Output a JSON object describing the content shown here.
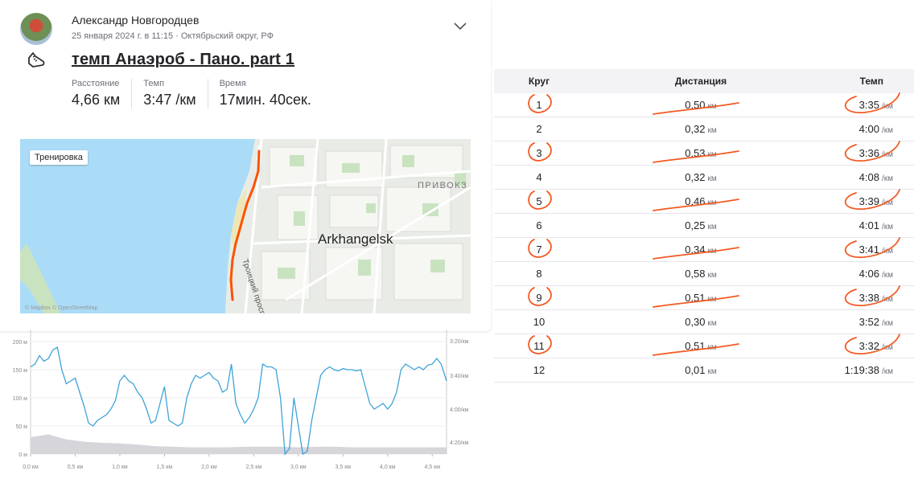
{
  "header": {
    "author": "Александр Новгородцев",
    "meta": "25 января 2024 г. в 11:15 · Октябрьский округ, РФ",
    "title": "темп Анаэроб - Пано. part 1",
    "icons": [
      "avatar",
      "chevron-down-icon",
      "shoe-icon"
    ]
  },
  "stats": [
    {
      "label": "Расстояние",
      "value": "4,66 км"
    },
    {
      "label": "Темп",
      "value": "3:47 /км"
    },
    {
      "label": "Время",
      "value": "17мин. 40сек."
    }
  ],
  "map": {
    "tag": "Тренировка",
    "city": "Arkhangelsk",
    "district": "ПРИВОКЗ",
    "street": "Троицкий просп",
    "credit": "© Mapbox © OpenStreetMap",
    "route_color": "#fc5200",
    "water_color": "#aadcf7"
  },
  "chart_data": {
    "type": "line",
    "title": "",
    "xlabel": "",
    "x_ticks": [
      "0,0 км",
      "0,5 км",
      "1,0 км",
      "1,5 км",
      "2,0 км",
      "2,5 км",
      "3,0 км",
      "3,5 км",
      "4,0 км",
      "4,5 км"
    ],
    "y_left_ticks": [
      "200 м",
      "150 м",
      "100 м",
      "50 м",
      "0 м"
    ],
    "y_right_ticks": [
      "3:20/км",
      "3:40/км",
      "4:00/км",
      "4:20/км"
    ],
    "xlim": [
      0,
      4.66
    ],
    "ylim_left": [
      0,
      200
    ],
    "series": [
      {
        "type": "line",
        "color": "#3ea3d8",
        "x": [
          0,
          0.05,
          0.1,
          0.15,
          0.2,
          0.25,
          0.3,
          0.35,
          0.4,
          0.45,
          0.5,
          0.55,
          0.6,
          0.65,
          0.7,
          0.75,
          0.8,
          0.85,
          0.9,
          0.95,
          1.0,
          1.05,
          1.1,
          1.15,
          1.2,
          1.25,
          1.3,
          1.35,
          1.4,
          1.45,
          1.5,
          1.55,
          1.6,
          1.65,
          1.7,
          1.75,
          1.8,
          1.85,
          1.9,
          1.95,
          2.0,
          2.05,
          2.1,
          2.15,
          2.2,
          2.25,
          2.3,
          2.35,
          2.4,
          2.45,
          2.5,
          2.55,
          2.6,
          2.65,
          2.7,
          2.75,
          2.8,
          2.85,
          2.9,
          2.95,
          3.0,
          3.05,
          3.1,
          3.15,
          3.2,
          3.25,
          3.3,
          3.35,
          3.4,
          3.45,
          3.5,
          3.55,
          3.6,
          3.65,
          3.7,
          3.75,
          3.8,
          3.85,
          3.9,
          3.95,
          4.0,
          4.05,
          4.1,
          4.15,
          4.2,
          4.25,
          4.3,
          4.35,
          4.4,
          4.45,
          4.5,
          4.55,
          4.6,
          4.66
        ],
        "y": [
          155,
          160,
          175,
          165,
          170,
          185,
          190,
          150,
          125,
          130,
          135,
          110,
          85,
          55,
          50,
          60,
          65,
          70,
          80,
          95,
          130,
          140,
          130,
          125,
          110,
          100,
          80,
          55,
          60,
          90,
          120,
          60,
          55,
          50,
          55,
          100,
          125,
          140,
          135,
          140,
          145,
          135,
          130,
          110,
          115,
          160,
          90,
          70,
          55,
          65,
          80,
          100,
          160,
          155,
          155,
          150,
          100,
          0,
          10,
          100,
          50,
          0,
          5,
          60,
          100,
          140,
          150,
          155,
          150,
          148,
          152,
          150,
          150,
          148,
          150,
          120,
          90,
          80,
          85,
          90,
          80,
          90,
          110,
          150,
          160,
          155,
          150,
          155,
          150,
          158,
          160,
          170,
          160,
          130
        ]
      },
      {
        "type": "area",
        "color": "#d5d5da",
        "x": [
          0,
          0.2,
          0.4,
          0.6,
          0.8,
          1.0,
          1.2,
          1.4,
          1.6,
          1.8,
          2.0,
          2.2,
          2.4,
          2.6,
          2.8,
          3.0,
          3.2,
          3.4,
          3.6,
          3.8,
          4.0,
          4.2,
          4.4,
          4.66
        ],
        "y": [
          30,
          35,
          26,
          22,
          20,
          19,
          17,
          14,
          13,
          12,
          12,
          12,
          13,
          13,
          13,
          12,
          13,
          13,
          12,
          12,
          12,
          12,
          12,
          12
        ]
      }
    ]
  },
  "laps": {
    "headers": [
      "Круг",
      "Дистанция",
      "Темп"
    ],
    "dist_unit": "км",
    "pace_unit": "/км",
    "rows": [
      {
        "lap": "1",
        "dist": "0,50",
        "pace": "3:35",
        "marked": true
      },
      {
        "lap": "2",
        "dist": "0,32",
        "pace": "4:00",
        "marked": false
      },
      {
        "lap": "3",
        "dist": "0,53",
        "pace": "3:36",
        "marked": true
      },
      {
        "lap": "4",
        "dist": "0,32",
        "pace": "4:08",
        "marked": false
      },
      {
        "lap": "5",
        "dist": "0,46",
        "pace": "3:39",
        "marked": true
      },
      {
        "lap": "6",
        "dist": "0,25",
        "pace": "4:01",
        "marked": false
      },
      {
        "lap": "7",
        "dist": "0,34",
        "pace": "3:41",
        "marked": true
      },
      {
        "lap": "8",
        "dist": "0,58",
        "pace": "4:06",
        "marked": false
      },
      {
        "lap": "9",
        "dist": "0,51",
        "pace": "3:38",
        "marked": true
      },
      {
        "lap": "10",
        "dist": "0,30",
        "pace": "3:52",
        "marked": false
      },
      {
        "lap": "11",
        "dist": "0,51",
        "pace": "3:32",
        "marked": true
      },
      {
        "lap": "12",
        "dist": "0,01",
        "pace": "1:19:38",
        "marked": false
      }
    ],
    "annotation_color": "#f25a22"
  }
}
